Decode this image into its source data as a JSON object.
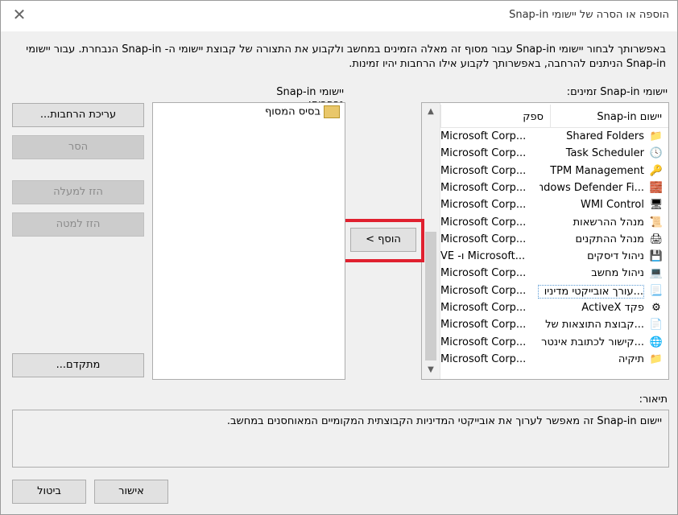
{
  "window": {
    "title": "הוספה או הסרה של יישומי Snap-in"
  },
  "intro": "באפשרותך לבחור יישומי Snap-in עבור מסוף זה מאלה הזמינים במחשב ולקבוע את התצורה של קבוצת יישומי ה- Snap-in הנבחרת. עבור יישומי Snap-in הניתנים להרחבה, באפשרותך לקבוע אילו הרחבות יהיו זמינות.",
  "available": {
    "label": "יישומי Snap-in זמינים:",
    "col_name": "יישום Snap-in",
    "col_vendor": "ספק",
    "items": [
      {
        "name": "Shared Folders",
        "vendor": "...Microsoft Corp",
        "icon": "shared-folders-icon",
        "glyph": "📁"
      },
      {
        "name": "Task Scheduler",
        "vendor": "...Microsoft Corp",
        "icon": "clock-icon",
        "glyph": "🕓"
      },
      {
        "name": "TPM Management",
        "vendor": "...Microsoft Corp",
        "icon": "chip-key-icon",
        "glyph": "🔑"
      },
      {
        "name": "...Windows Defender Fi",
        "vendor": "...Microsoft Corp",
        "icon": "firewall-icon",
        "glyph": "🧱"
      },
      {
        "name": "WMI Control",
        "vendor": "...Microsoft Corp",
        "icon": "computer-settings-icon",
        "glyph": "🖥"
      },
      {
        "name": "מנהל ההרשאות",
        "vendor": "...Microsoft Corp",
        "icon": "certificate-icon",
        "glyph": "📜"
      },
      {
        "name": "מנהל ההתקנים",
        "vendor": "...Microsoft Corp",
        "icon": "device-manager-icon",
        "glyph": "🖨"
      },
      {
        "name": "ניהול דיסקים",
        "vendor": "...Microsoft ו- VE",
        "icon": "disk-icon",
        "glyph": "💾"
      },
      {
        "name": "ניהול מחשב",
        "vendor": "...Microsoft Corp",
        "icon": "computer-management-icon",
        "glyph": "💻"
      },
      {
        "name": "...עורך אובייקטי מדיניו",
        "vendor": "...Microsoft Corp",
        "icon": "policy-scroll-icon",
        "glyph": "📃"
      },
      {
        "name": "פקד ActiveX",
        "vendor": "...Microsoft Corp",
        "icon": "activex-icon",
        "glyph": "⚙"
      },
      {
        "name": "...קבוצת התוצאות של",
        "vendor": "...Microsoft Corp",
        "icon": "report-icon",
        "glyph": "📄"
      },
      {
        "name": "...קישור לכתובת אינטר",
        "vendor": "...Microsoft Corp",
        "icon": "web-link-icon",
        "glyph": "🌐"
      },
      {
        "name": "תיקיה",
        "vendor": "...Microsoft Corp",
        "icon": "folder-icon",
        "glyph": "📁"
      }
    ]
  },
  "selected": {
    "label": "יישומי Snap-in נבחרים:",
    "items": [
      {
        "name": "בסיס המסוף",
        "icon": "folder-icon"
      }
    ]
  },
  "buttons": {
    "edit_extensions": "עריכת הרחבות...",
    "remove": "הסר",
    "move_up": "הזז למעלה",
    "move_down": "הזז למטה",
    "advanced": "מתקדם...",
    "add": "הוסף >",
    "ok": "אישור",
    "cancel": "ביטול"
  },
  "description": {
    "label": "תיאור:",
    "text": "יישום Snap-in זה מאפשר לערוך את אובייקטי המדיניות הקבוצתית המקומיים המאוחסנים במחשב."
  },
  "colors": {
    "highlight": "#e0202f",
    "disabled_text": "#8b8b8b"
  }
}
